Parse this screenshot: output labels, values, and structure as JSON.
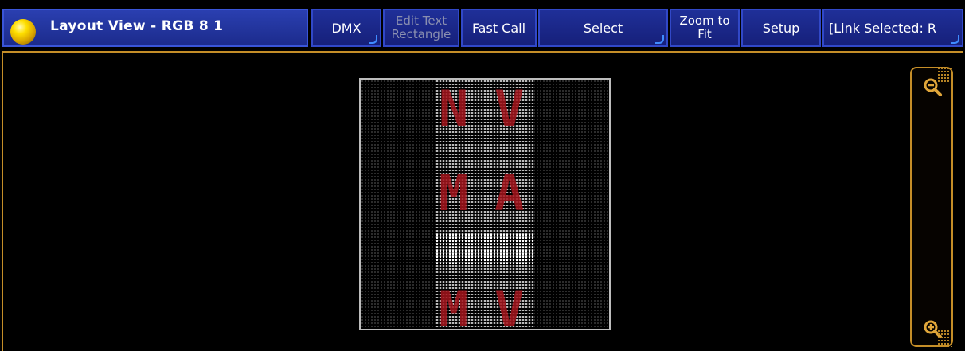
{
  "title": "Layout View - RGB 8 1",
  "toolbar": {
    "dmx": "DMX",
    "edit_text_1": "Edit Text",
    "edit_text_2": "Rectangle",
    "fast_call": "Fast Call",
    "select": "Select",
    "zoom_fit_1": "Zoom to",
    "zoom_fit_2": "Fit",
    "setup": "Setup",
    "link_selected": "[Link Selected: R"
  },
  "canvas": {
    "letters": [
      "N",
      "V",
      "M",
      "A",
      "M",
      "V"
    ]
  },
  "colors": {
    "title_bg": "#1c2b8c",
    "accent_frame": "#c58e28",
    "letter_red": "#a4141c"
  },
  "icons": {
    "title": "yellow-orb-icon",
    "zoom_out": "zoom-out-icon",
    "zoom_in": "zoom-in-icon"
  }
}
